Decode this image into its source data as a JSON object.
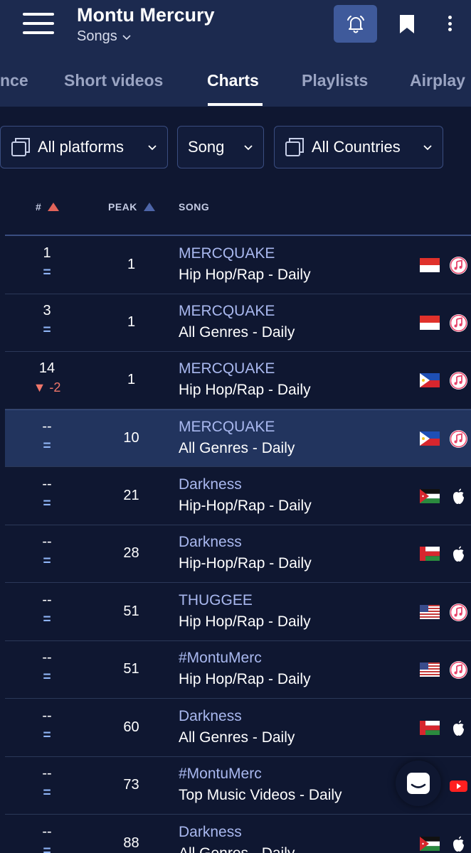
{
  "header": {
    "artist_name": "Montu Mercury",
    "subsection": "Songs"
  },
  "tabs": [
    {
      "label": "nce",
      "active": false
    },
    {
      "label": "Short videos",
      "active": false
    },
    {
      "label": "Charts",
      "active": true
    },
    {
      "label": "Playlists",
      "active": false
    },
    {
      "label": "Airplay",
      "active": false
    }
  ],
  "filters": {
    "platforms": "All platforms",
    "type": "Song",
    "countries": "All Countries"
  },
  "columns": {
    "rank": "#",
    "peak": "PEAK",
    "song": "SONG"
  },
  "rows": [
    {
      "rank": "1",
      "change": "=",
      "peak": "1",
      "title": "MERCQUAKE",
      "chart": "Hip Hop/Rap - Daily",
      "flag": "indonesia-flag",
      "platform": "itunes-icon"
    },
    {
      "rank": "3",
      "change": "=",
      "peak": "1",
      "title": "MERCQUAKE",
      "chart": "All Genres - Daily",
      "flag": "indonesia-flag",
      "platform": "itunes-icon"
    },
    {
      "rank": "14",
      "change": "▼ -2",
      "peak": "1",
      "title": "MERCQUAKE",
      "chart": "Hip Hop/Rap - Daily",
      "flag": "philippines-flag",
      "platform": "itunes-icon"
    },
    {
      "rank": "--",
      "change": "=",
      "peak": "10",
      "title": "MERCQUAKE",
      "chart": "All Genres - Daily",
      "flag": "philippines-flag",
      "platform": "itunes-icon"
    },
    {
      "rank": "--",
      "change": "=",
      "peak": "21",
      "title": "Darkness",
      "chart": "Hip-Hop/Rap - Daily",
      "flag": "jordan-flag",
      "platform": "apple-icon"
    },
    {
      "rank": "--",
      "change": "=",
      "peak": "28",
      "title": "Darkness",
      "chart": "Hip-Hop/Rap - Daily",
      "flag": "oman-flag",
      "platform": "apple-icon"
    },
    {
      "rank": "--",
      "change": "=",
      "peak": "51",
      "title": "THUGGEE",
      "chart": "Hip Hop/Rap - Daily",
      "flag": "usa-flag",
      "platform": "itunes-icon"
    },
    {
      "rank": "--",
      "change": "=",
      "peak": "51",
      "title": "#MontuMerc",
      "chart": "Hip Hop/Rap - Daily",
      "flag": "usa-flag",
      "platform": "itunes-icon"
    },
    {
      "rank": "--",
      "change": "=",
      "peak": "60",
      "title": "Darkness",
      "chart": "All Genres - Daily",
      "flag": "oman-flag",
      "platform": "apple-icon"
    },
    {
      "rank": "--",
      "change": "=",
      "peak": "73",
      "title": "#MontuMerc",
      "chart": "Top Music Videos - Daily",
      "flag": "none",
      "platform": "youtube-icon"
    },
    {
      "rank": "--",
      "change": "=",
      "peak": "88",
      "title": "Darkness",
      "chart": "All Genres - Daily",
      "flag": "jordan-flag",
      "platform": "apple-icon"
    }
  ],
  "colors": {
    "background": "#0f1731",
    "header": "#1c2a4f",
    "accent": "#3f5a9b",
    "link": "#a9b8ef",
    "down": "#f0766a",
    "up_sort": "#e2645a"
  }
}
